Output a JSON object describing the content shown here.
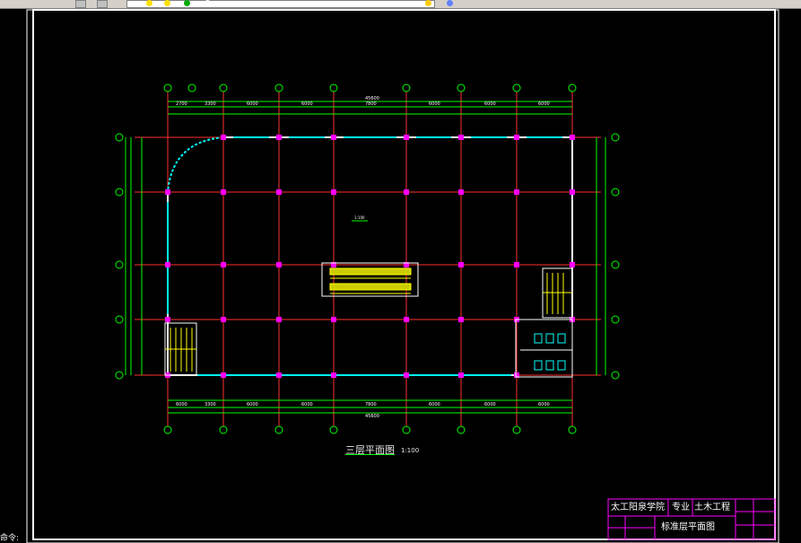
{
  "toolbar": {
    "layer_combo_value": ""
  },
  "drawing": {
    "plan_title": "三层平面图",
    "plan_scale": "1:100",
    "annotation": "1:100",
    "overall_dim_top": "45600",
    "overall_dim_bottom": "45600",
    "top_bay_dims": [
      "2700",
      "3300",
      "6000",
      "6000",
      "7800",
      "6000",
      "6000",
      "6000"
    ],
    "bottom_bay_dims": [
      "6000",
      "3300",
      "6000",
      "6000",
      "7800",
      "6000",
      "6000",
      "6000"
    ],
    "left_dims": [
      "8100",
      "7800",
      "8100",
      "6000"
    ],
    "right_dims": [
      "8100",
      "7800",
      "8100",
      "6000"
    ],
    "axis_numbers": [
      "①",
      "②",
      "③",
      "④",
      "⑤",
      "⑥",
      "⑦",
      "⑧",
      "⑨"
    ],
    "axis_letters": [
      "Ⓔ",
      "Ⓓ",
      "Ⓒ",
      "Ⓑ",
      "Ⓐ"
    ]
  },
  "title_block": {
    "school": "太工阳泉学院",
    "major_label": "专业",
    "major": "土木工程",
    "drawing_name": "标准层平面图",
    "colors": {
      "border": "#ff00ff",
      "text": "#ffffff"
    }
  },
  "command_line": "命令:",
  "colors": {
    "background": "#000000",
    "grid_axis": "#ff3030",
    "column": "#ff00ff",
    "dimension": "#00ff00",
    "wall": "#ffffff",
    "window": "#00ffff",
    "stair": "#ffff00"
  }
}
